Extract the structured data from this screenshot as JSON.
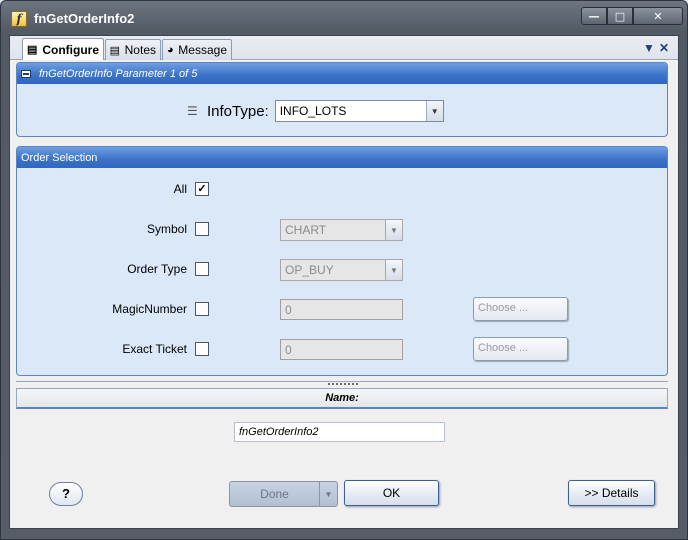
{
  "window": {
    "title": "fnGetOrderInfo2",
    "icon": "f"
  },
  "tabs": [
    {
      "label": "Configure",
      "icon": "configure-icon",
      "active": true
    },
    {
      "label": "Notes",
      "icon": "notes-icon",
      "active": false
    },
    {
      "label": "Message",
      "icon": "globe-icon",
      "active": false
    }
  ],
  "param_panel": {
    "title": "fnGetOrderInfo Parameter 1 of 5",
    "info_label": "InfoType:",
    "info_value": "INFO_LOTS"
  },
  "order_panel": {
    "title": "Order Selection",
    "all_label": "All",
    "all_checked": true,
    "symbol_label": "Symbol",
    "symbol_value": "CHART",
    "order_type_label": "Order Type",
    "order_type_value": "OP_BUY",
    "magic_label": "MagicNumber",
    "magic_value": "0",
    "ticket_label": "Exact Ticket",
    "ticket_value": "0",
    "choose_label": "Choose ..."
  },
  "name_section": {
    "header": "Name:",
    "value": "fnGetOrderInfo2"
  },
  "buttons": {
    "help": "?",
    "done": "Done",
    "ok": "OK",
    "details": ">> Details"
  },
  "colors": {
    "panel_header": "#3b72c8",
    "panel_body": "#dbe8f8"
  }
}
